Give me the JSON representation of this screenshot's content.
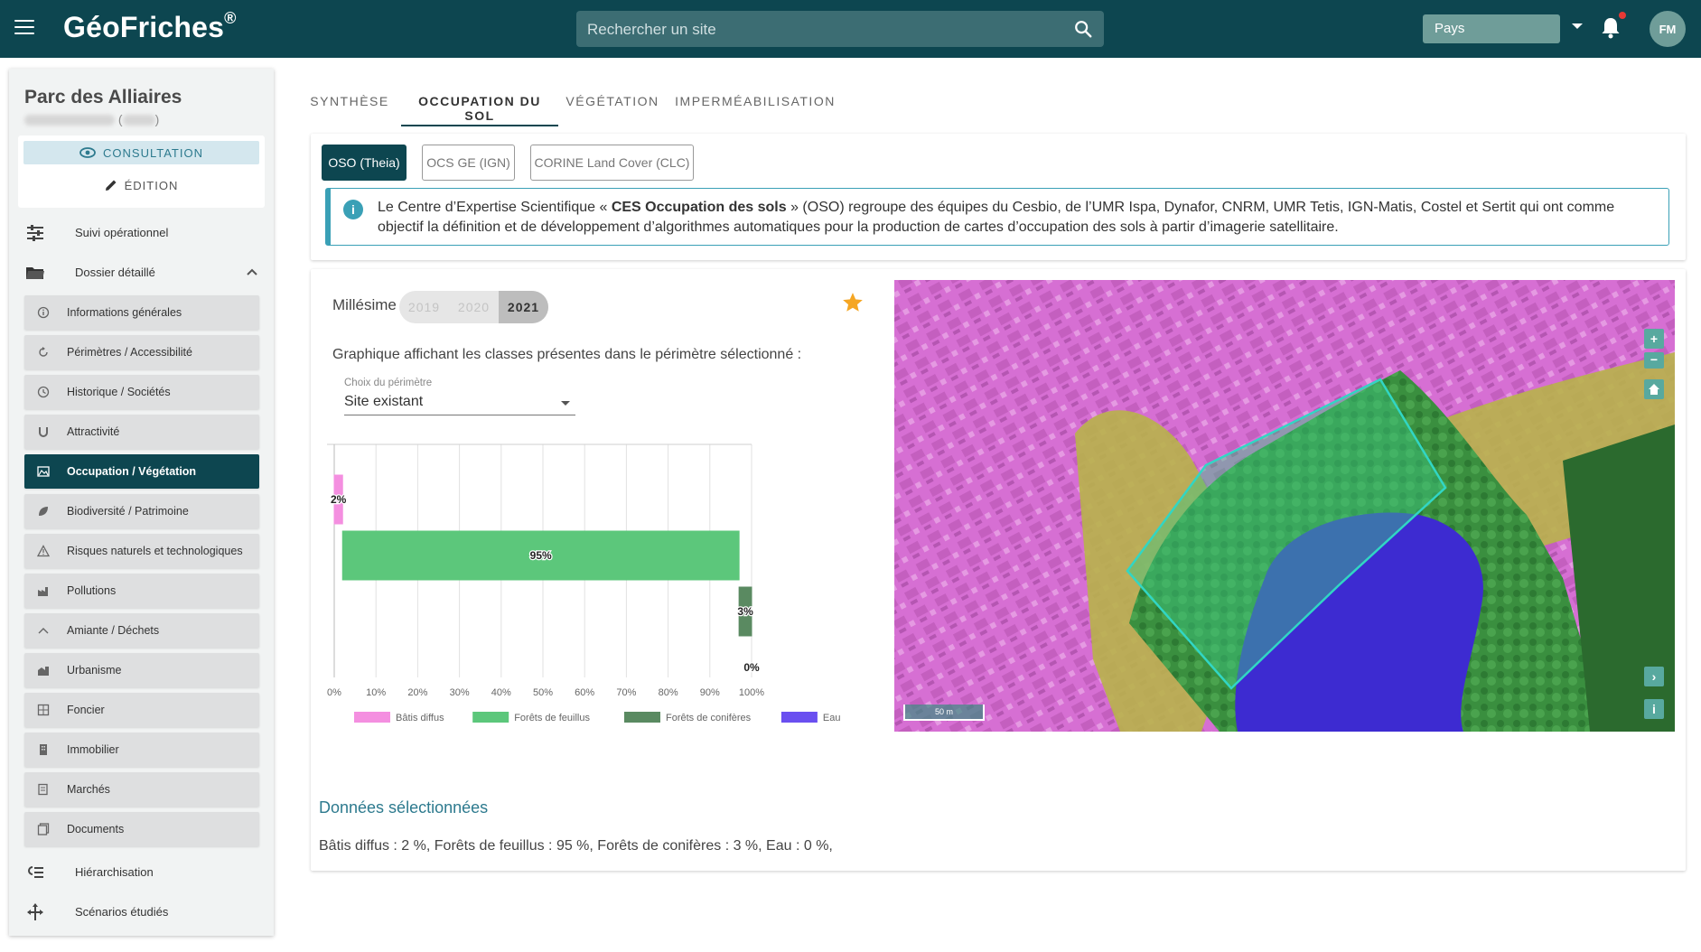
{
  "app": {
    "brand": "GéoFriches",
    "brand_mark": "®",
    "search_placeholder": "Rechercher un site",
    "country_select": "Pays",
    "user_initials": "FM"
  },
  "site": {
    "name": "Parc des Alliaires",
    "subtitle_open": "(",
    "subtitle_close": ")"
  },
  "modes": {
    "consultation": "CONSULTATION",
    "edition": "ÉDITION",
    "active": "consultation"
  },
  "sidebar": {
    "suivi": "Suivi opérationnel",
    "dossier": "Dossier détaillé",
    "sub_items": [
      {
        "label": "Informations générales",
        "icon": "info-icon"
      },
      {
        "label": "Périmètres / Accessibilité",
        "icon": "refresh-icon"
      },
      {
        "label": "Historique / Sociétés",
        "icon": "history-icon"
      },
      {
        "label": "Attractivité",
        "icon": "magnet-icon"
      },
      {
        "label": "Occupation / Végétation",
        "icon": "landscape-icon",
        "active": true
      },
      {
        "label": "Biodiversité / Patrimoine",
        "icon": "leaf-icon"
      },
      {
        "label": "Risques naturels et technologiques",
        "icon": "warning-icon"
      },
      {
        "label": "Pollutions",
        "icon": "factory-icon"
      },
      {
        "label": "Amiante / Déchets",
        "icon": "waste-icon"
      },
      {
        "label": "Urbanisme",
        "icon": "city-icon"
      },
      {
        "label": "Foncier",
        "icon": "parcel-icon"
      },
      {
        "label": "Immobilier",
        "icon": "building-icon"
      },
      {
        "label": "Marchés",
        "icon": "market-icon"
      },
      {
        "label": "Documents",
        "icon": "documents-icon"
      }
    ],
    "hierarchisation": "Hiérarchisation",
    "scenarios": "Scénarios étudiés"
  },
  "tabs": [
    "SYNTHÈSE",
    "OCCUPATION DU SOL",
    "VÉGÉTATION",
    "IMPERMÉABILISATION"
  ],
  "active_tab": "OCCUPATION DU SOL",
  "sources": {
    "items": [
      "OSO (Theia)",
      "OCS GE (IGN)",
      "CORINE Land Cover (CLC)"
    ],
    "active": "OSO (Theia)"
  },
  "info": {
    "prefix": "Le Centre d’Expertise Scientifique « ",
    "bold": "CES Occupation des sols",
    "suffix": " » (OSO) regroupe des équipes du Cesbio, de l’UMR Ispa, Dynafor, CNRM, UMR Tetis, IGN-Matis, Costel et Sertit qui ont comme objectif la définition et de développement d’algorithmes automatiques pour la production de cartes d’occupation des sols à partir d’imagerie satellitaire."
  },
  "millesime": {
    "label": "Millésime",
    "years": [
      "2019",
      "2020",
      "2021"
    ],
    "active": "2021"
  },
  "chart_caption": "Graphique affichant les classes présentes dans le périmètre sélectionné :",
  "perimetre": {
    "label": "Choix du périmètre",
    "value": "Site existant"
  },
  "chart_data": {
    "type": "bar",
    "orientation": "horizontal",
    "xlim": [
      0,
      100
    ],
    "x_ticks": [
      "0%",
      "10%",
      "20%",
      "30%",
      "40%",
      "50%",
      "60%",
      "70%",
      "80%",
      "90%",
      "100%"
    ],
    "grid": true,
    "legend_position": "bottom",
    "series": [
      {
        "name": "Bâtis diffus",
        "value": 2,
        "label": "2%",
        "color": "#f48fe0"
      },
      {
        "name": "Forêts de feuillus",
        "value": 95,
        "label": "95%",
        "color": "#5cc77b"
      },
      {
        "name": "Forêts de conifères",
        "value": 3,
        "label": "3%",
        "color": "#5a8a61"
      },
      {
        "name": "Eau",
        "value": 0,
        "label": "0%",
        "color": "#6a4ff0"
      }
    ]
  },
  "donnees": {
    "title": "Données sélectionnées",
    "text": "Bâtis diffus : 2 %, Forêts de feuillus : 95 %, Forêts de conifères : 3 %, Eau : 0 %,"
  },
  "map": {
    "scale_label": "50 m",
    "zoom_in": "+",
    "zoom_out": "−",
    "expand": "›",
    "info": "i"
  },
  "colors": {
    "primary": "#0d4650",
    "accent": "#3aa0b6",
    "star": "#f5a623"
  }
}
